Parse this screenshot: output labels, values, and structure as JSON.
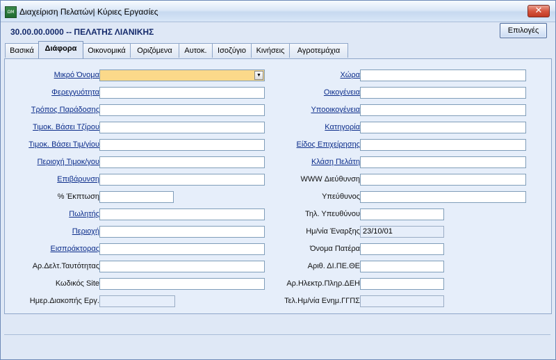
{
  "window": {
    "title": "Διαχείριση Πελατών| Κύριες Εργασίες",
    "app_icon": "app-icon",
    "close_icon": "close-icon"
  },
  "header": {
    "customer_code": "30.00.00.0000 -- ΠΕΛΑΤΗΣ ΛΙΑΝΙΚΗΣ",
    "options_label": "Επιλογές"
  },
  "tabs": [
    {
      "label": "Βασικά",
      "active": false
    },
    {
      "label": "Διάφορα",
      "active": true
    },
    {
      "label": "Οικονομικά",
      "active": false
    },
    {
      "label": "Οριζόμενα",
      "active": false
    },
    {
      "label": "Αυτοκ.",
      "active": false
    },
    {
      "label": "Ισοζύγιο",
      "active": false
    },
    {
      "label": "Κινήσεις",
      "active": false
    },
    {
      "label": "Αγροτεμάχια",
      "active": false
    }
  ],
  "left_fields": [
    {
      "label": "Μικρό Όνομα",
      "value": "",
      "link": true
    },
    {
      "label": "Φερεγγυότητα",
      "value": "",
      "link": true
    },
    {
      "label": "Τρόπος Παράδοσης",
      "value": "",
      "link": true
    },
    {
      "label": "Τιμοκ. Βάσει Τζίρου",
      "value": "",
      "link": true
    },
    {
      "label": "Τιμοκ. Βάσει Τιμ/γίου",
      "value": "",
      "link": true
    },
    {
      "label": "Περιοχή Τιμοκ/γου",
      "value": "",
      "link": true
    },
    {
      "label": "Επιβάρυνση",
      "value": "",
      "link": true
    },
    {
      "label": "% Έκπτωση",
      "value": "",
      "link": false
    },
    {
      "label": "Πωλητής",
      "value": "",
      "link": true
    },
    {
      "label": "Περιοχή",
      "value": "",
      "link": true
    },
    {
      "label": "Εισπράκτορας",
      "value": "",
      "link": true
    },
    {
      "label": "Αρ.Δελτ.Ταυτότητας",
      "value": "",
      "link": false
    },
    {
      "label": "Κωδικός  Site",
      "value": "",
      "link": false
    },
    {
      "label": "Ημερ.Διακοπής Εργ.",
      "value": "",
      "link": false
    }
  ],
  "right_fields": [
    {
      "label": "Χώρα",
      "value": "",
      "link": true
    },
    {
      "label": "Οικογένεια",
      "value": "",
      "link": true
    },
    {
      "label": "Υποοικογένεια",
      "value": "",
      "link": true
    },
    {
      "label": "Κατηγορία",
      "value": "",
      "link": true
    },
    {
      "label": "Είδος Επιχείρησης",
      "value": "",
      "link": true
    },
    {
      "label": "Κλάση Πελάτη",
      "value": "",
      "link": true
    },
    {
      "label": "WWW  Διεύθυνση",
      "value": "",
      "link": false
    },
    {
      "label": "Υπεύθυνος",
      "value": "",
      "link": false
    },
    {
      "label": "Τηλ. Υπευθύνου",
      "value": "",
      "link": false
    },
    {
      "label": "Ημ/νία Έναρξης",
      "value": "23/10/01",
      "link": false
    },
    {
      "label": "Όνομα Πατέρα",
      "value": "",
      "link": false
    },
    {
      "label": "Αριθ. ΔΙ.ΠΕ.ΘΕ",
      "value": "",
      "link": false
    },
    {
      "label": "Αρ.Ηλεκτρ.Πληρ.ΔΕΗ",
      "value": "",
      "link": false
    },
    {
      "label": "Τελ.Ημ/νία Ενημ.ΓΓΠΣ",
      "value": "",
      "link": false
    }
  ],
  "dropdown_icon": "chevron-down-icon"
}
